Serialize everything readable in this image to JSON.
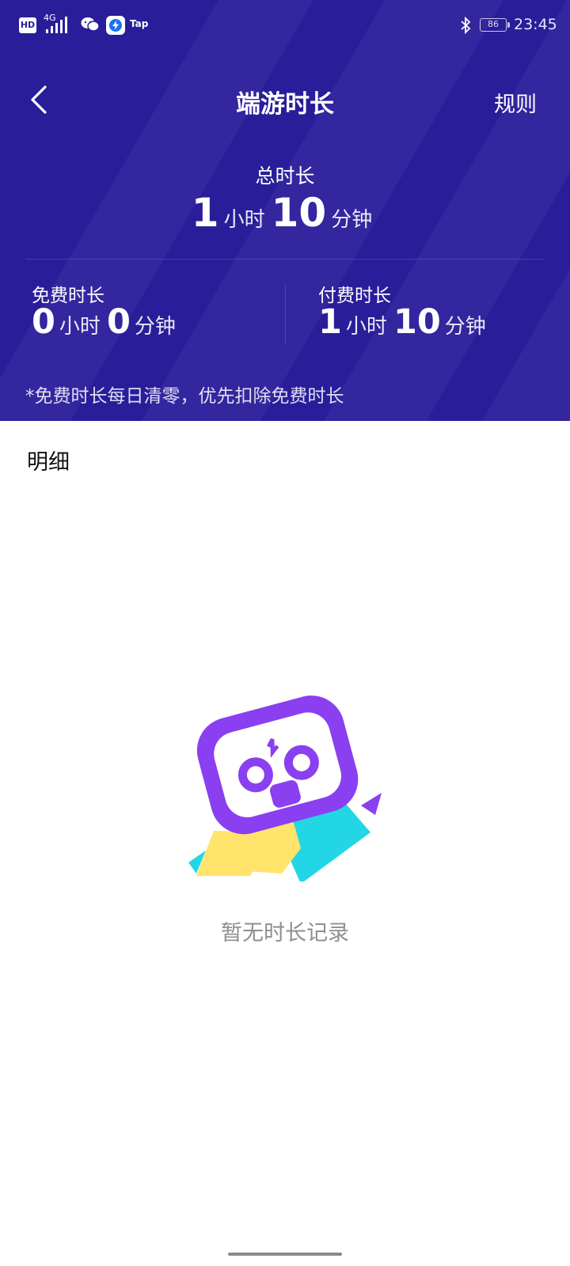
{
  "status_bar": {
    "network_hd": "HD",
    "network_type": "4G",
    "app_label": "Tap",
    "battery": "86",
    "time": "23:45"
  },
  "header": {
    "title": "端游时长",
    "rules_label": "规则"
  },
  "total": {
    "label": "总时长",
    "hours": "1",
    "hour_unit": "小时",
    "minutes": "10",
    "minute_unit": "分钟"
  },
  "free": {
    "label": "免费时长",
    "hours": "0",
    "hour_unit": "小时",
    "minutes": "0",
    "minute_unit": "分钟"
  },
  "paid": {
    "label": "付费时长",
    "hours": "1",
    "hour_unit": "小时",
    "minutes": "10",
    "minute_unit": "分钟"
  },
  "note": "*免费时长每日清零，优先扣除免费时长",
  "detail": {
    "title": "明细",
    "empty_text": "暂无时长记录"
  },
  "colors": {
    "hero_bg": "#2a1d9a",
    "controller_purple": "#8a3ff0",
    "yellow": "#ffe36b",
    "cyan": "#22d6e6"
  }
}
